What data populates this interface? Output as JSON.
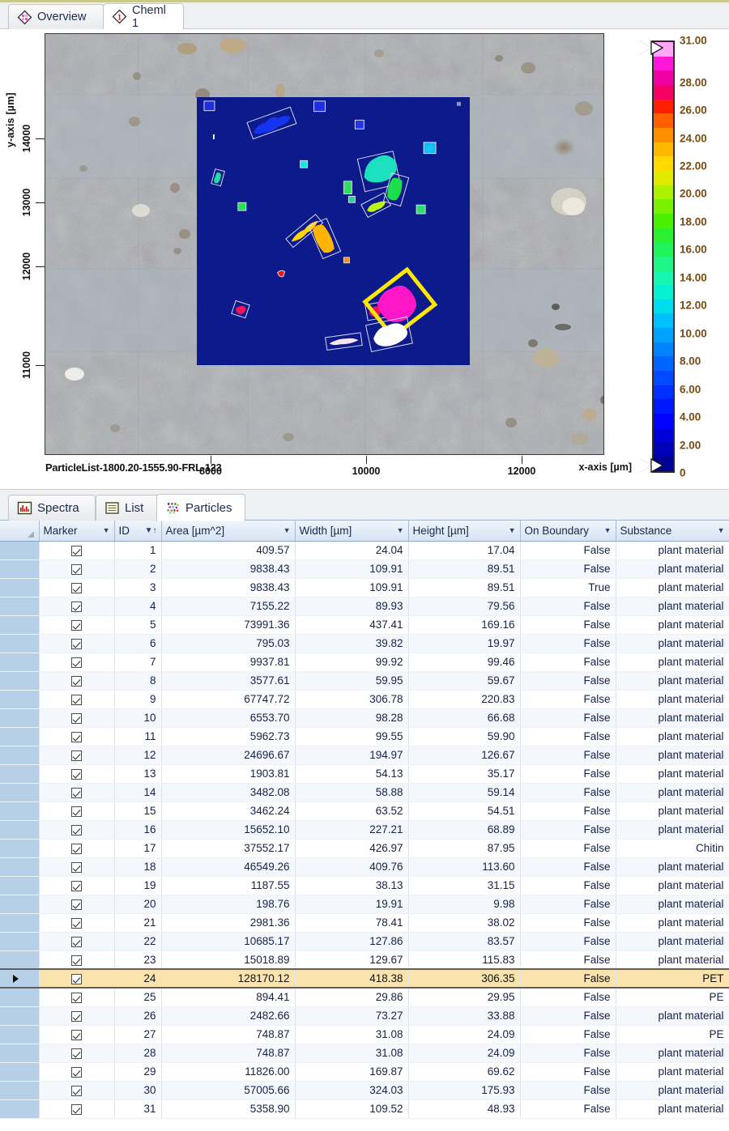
{
  "top_tabs": [
    {
      "label": "Overview",
      "icon": "diamond-pattern-icon",
      "active": false
    },
    {
      "label": "Cheml 1",
      "icon": "diamond-one-icon",
      "active": true
    }
  ],
  "bottom_tabs": [
    {
      "label": "Spectra",
      "icon": "spectrum-chart-icon",
      "active": false
    },
    {
      "label": "List",
      "icon": "list-lines-icon",
      "active": false
    },
    {
      "label": "Particles",
      "icon": "particles-dots-icon",
      "active": true
    }
  ],
  "plot": {
    "y_axis_title": "y-axis [µm]",
    "x_axis_title": "x-axis [µm]",
    "caption": "ParticleList-1800.20-1555.90-FRL-123",
    "x_ticks": [
      "8000",
      "10000",
      "12000"
    ],
    "y_ticks": [
      "11000",
      "12000",
      "13000",
      "14000"
    ]
  },
  "chart_data": {
    "type": "heatmap",
    "title": "ParticleList-1800.20-1555.90-FRL-123",
    "xlabel": "x-axis [µm]",
    "ylabel": "y-axis [µm]",
    "xlim": [
      6900,
      12900
    ],
    "ylim": [
      10350,
      14600
    ],
    "x_tick_values": [
      8000,
      10000,
      12000
    ],
    "y_tick_values": [
      11000,
      12000,
      13000,
      14000
    ],
    "colorbar": {
      "label": "",
      "min": 0,
      "max": 31,
      "tick_values": [
        0,
        2,
        4,
        6,
        8,
        10,
        12,
        14,
        16,
        18,
        20,
        22,
        24,
        26,
        28,
        31
      ],
      "tick_labels": [
        "0",
        "2.00",
        "4.00",
        "6.00",
        "8.00",
        "10.00",
        "12.00",
        "14.00",
        "16.00",
        "18.00",
        "20.00",
        "22.00",
        "24.00",
        "26.00",
        "28.00",
        "31.00"
      ],
      "colormap": "jet-to-white"
    },
    "grid": false,
    "legend": "none",
    "overlay_field_background_value": 1,
    "particles_plotted": 31
  },
  "colorbar_ticks": [
    {
      "label": "31.00",
      "value": 31
    },
    {
      "label": "28.00",
      "value": 28
    },
    {
      "label": "26.00",
      "value": 26
    },
    {
      "label": "24.00",
      "value": 24
    },
    {
      "label": "22.00",
      "value": 22
    },
    {
      "label": "20.00",
      "value": 20
    },
    {
      "label": "18.00",
      "value": 18
    },
    {
      "label": "16.00",
      "value": 16
    },
    {
      "label": "14.00",
      "value": 14
    },
    {
      "label": "12.00",
      "value": 12
    },
    {
      "label": "10.00",
      "value": 10
    },
    {
      "label": "8.00",
      "value": 8
    },
    {
      "label": "6.00",
      "value": 6
    },
    {
      "label": "4.00",
      "value": 4
    },
    {
      "label": "2.00",
      "value": 2
    },
    {
      "label": "0",
      "value": 0
    }
  ],
  "table": {
    "columns": [
      {
        "key": "marker",
        "label": "Marker",
        "align": "center",
        "dropdown": true,
        "sorted": false
      },
      {
        "key": "id",
        "label": "ID",
        "align": "right",
        "dropdown": true,
        "sorted": true
      },
      {
        "key": "area",
        "label": "Area [µm^2]",
        "align": "right",
        "dropdown": true,
        "sorted": false
      },
      {
        "key": "width",
        "label": "Width [µm]",
        "align": "right",
        "dropdown": true,
        "sorted": false
      },
      {
        "key": "height",
        "label": "Height [µm]",
        "align": "right",
        "dropdown": true,
        "sorted": false
      },
      {
        "key": "boundary",
        "label": "On Boundary",
        "align": "right",
        "dropdown": true,
        "sorted": false
      },
      {
        "key": "substance",
        "label": "Substance",
        "align": "right",
        "dropdown": true,
        "sorted": false
      }
    ],
    "selected_row_id": 24,
    "rows": [
      {
        "marker": true,
        "id": "1",
        "area": "409.57",
        "width": "24.04",
        "height": "17.04",
        "boundary": "False",
        "substance": "plant material"
      },
      {
        "marker": true,
        "id": "2",
        "area": "9838.43",
        "width": "109.91",
        "height": "89.51",
        "boundary": "False",
        "substance": "plant material"
      },
      {
        "marker": true,
        "id": "3",
        "area": "9838.43",
        "width": "109.91",
        "height": "89.51",
        "boundary": "True",
        "substance": "plant material"
      },
      {
        "marker": true,
        "id": "4",
        "area": "7155.22",
        "width": "89.93",
        "height": "79.56",
        "boundary": "False",
        "substance": "plant material"
      },
      {
        "marker": true,
        "id": "5",
        "area": "73991.36",
        "width": "437.41",
        "height": "169.16",
        "boundary": "False",
        "substance": "plant material"
      },
      {
        "marker": true,
        "id": "6",
        "area": "795.03",
        "width": "39.82",
        "height": "19.97",
        "boundary": "False",
        "substance": "plant material"
      },
      {
        "marker": true,
        "id": "7",
        "area": "9937.81",
        "width": "99.92",
        "height": "99.46",
        "boundary": "False",
        "substance": "plant material"
      },
      {
        "marker": true,
        "id": "8",
        "area": "3577.61",
        "width": "59.95",
        "height": "59.67",
        "boundary": "False",
        "substance": "plant material"
      },
      {
        "marker": true,
        "id": "9",
        "area": "67747.72",
        "width": "306.78",
        "height": "220.83",
        "boundary": "False",
        "substance": "plant material"
      },
      {
        "marker": true,
        "id": "10",
        "area": "6553.70",
        "width": "98.28",
        "height": "66.68",
        "boundary": "False",
        "substance": "plant material"
      },
      {
        "marker": true,
        "id": "11",
        "area": "5962.73",
        "width": "99.55",
        "height": "59.90",
        "boundary": "False",
        "substance": "plant material"
      },
      {
        "marker": true,
        "id": "12",
        "area": "24696.67",
        "width": "194.97",
        "height": "126.67",
        "boundary": "False",
        "substance": "plant material"
      },
      {
        "marker": true,
        "id": "13",
        "area": "1903.81",
        "width": "54.13",
        "height": "35.17",
        "boundary": "False",
        "substance": "plant material"
      },
      {
        "marker": true,
        "id": "14",
        "area": "3482.08",
        "width": "58.88",
        "height": "59.14",
        "boundary": "False",
        "substance": "plant material"
      },
      {
        "marker": true,
        "id": "15",
        "area": "3462.24",
        "width": "63.52",
        "height": "54.51",
        "boundary": "False",
        "substance": "plant material"
      },
      {
        "marker": true,
        "id": "16",
        "area": "15652.10",
        "width": "227.21",
        "height": "68.89",
        "boundary": "False",
        "substance": "plant material"
      },
      {
        "marker": true,
        "id": "17",
        "area": "37552.17",
        "width": "426.97",
        "height": "87.95",
        "boundary": "False",
        "substance": "Chitin"
      },
      {
        "marker": true,
        "id": "18",
        "area": "46549.26",
        "width": "409.76",
        "height": "113.60",
        "boundary": "False",
        "substance": "plant material"
      },
      {
        "marker": true,
        "id": "19",
        "area": "1187.55",
        "width": "38.13",
        "height": "31.15",
        "boundary": "False",
        "substance": "plant material"
      },
      {
        "marker": true,
        "id": "20",
        "area": "198.76",
        "width": "19.91",
        "height": "9.98",
        "boundary": "False",
        "substance": "plant material"
      },
      {
        "marker": true,
        "id": "21",
        "area": "2981.36",
        "width": "78.41",
        "height": "38.02",
        "boundary": "False",
        "substance": "plant material"
      },
      {
        "marker": true,
        "id": "22",
        "area": "10685.17",
        "width": "127.86",
        "height": "83.57",
        "boundary": "False",
        "substance": "plant material"
      },
      {
        "marker": true,
        "id": "23",
        "area": "15018.89",
        "width": "129.67",
        "height": "115.83",
        "boundary": "False",
        "substance": "plant material"
      },
      {
        "marker": true,
        "id": "24",
        "area": "128170.12",
        "width": "418.38",
        "height": "306.35",
        "boundary": "False",
        "substance": "PET"
      },
      {
        "marker": true,
        "id": "25",
        "area": "894.41",
        "width": "29.86",
        "height": "29.95",
        "boundary": "False",
        "substance": "PE"
      },
      {
        "marker": true,
        "id": "26",
        "area": "2482.66",
        "width": "73.27",
        "height": "33.88",
        "boundary": "False",
        "substance": "plant material"
      },
      {
        "marker": true,
        "id": "27",
        "area": "748.87",
        "width": "31.08",
        "height": "24.09",
        "boundary": "False",
        "substance": "PE"
      },
      {
        "marker": true,
        "id": "28",
        "area": "748.87",
        "width": "31.08",
        "height": "24.09",
        "boundary": "False",
        "substance": "plant material"
      },
      {
        "marker": true,
        "id": "29",
        "area": "11826.00",
        "width": "169.87",
        "height": "69.62",
        "boundary": "False",
        "substance": "plant material"
      },
      {
        "marker": true,
        "id": "30",
        "area": "57005.66",
        "width": "324.03",
        "height": "175.93",
        "boundary": "False",
        "substance": "plant material"
      },
      {
        "marker": true,
        "id": "31",
        "area": "5358.90",
        "width": "109.52",
        "height": "48.93",
        "boundary": "False",
        "substance": "plant material"
      }
    ]
  },
  "colors": {
    "selection_row": "#fbe3ae",
    "header_blue": "#d6e4f3",
    "overlay_background": "#0c1a8c",
    "selected_particle_box": "#ffe800",
    "tick_label": "#7a4a12"
  }
}
